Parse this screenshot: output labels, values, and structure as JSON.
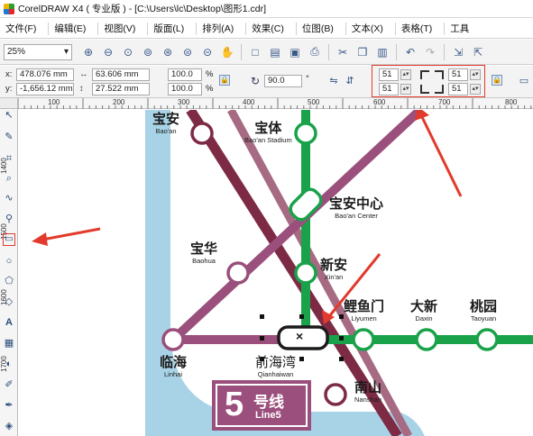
{
  "window": {
    "title": "CorelDRAW X4 ( 专业版 ) - [C:\\Users\\lc\\Desktop\\图形1.cdr]"
  },
  "menu": [
    {
      "label": "文件(F)"
    },
    {
      "label": "编辑(E)"
    },
    {
      "label": "视图(V)"
    },
    {
      "label": "版面(L)"
    },
    {
      "label": "排列(A)"
    },
    {
      "label": "效果(C)"
    },
    {
      "label": "位图(B)"
    },
    {
      "label": "文本(X)"
    },
    {
      "label": "表格(T)"
    },
    {
      "label": "工具"
    }
  ],
  "toolbar": {
    "zoom_value": "25%",
    "icons": [
      "zoom-in-icon",
      "zoom-out-icon",
      "zoom-selected-icon",
      "zoom-all-icon",
      "zoom-page-icon",
      "zoom-width-icon",
      "zoom-height-icon",
      "pan-icon",
      "new-icon",
      "open-icon",
      "save-icon",
      "print-icon",
      "cut-icon",
      "copy-icon",
      "paste-icon",
      "undo-icon",
      "redo-icon",
      "import-icon",
      "export-icon"
    ]
  },
  "property_bar": {
    "x_label": "x:",
    "x_value": "478.076 mm",
    "y_label": "y:",
    "y_value": "-1,656.12 mm",
    "w_value": "63.606 mm",
    "h_value": "27.522 mm",
    "scale_w": "100.0",
    "scale_h": "100.0",
    "percent": "%",
    "rotation": "90.0",
    "degree": "°",
    "corner_tl": "51",
    "corner_bl": "51",
    "corner_tr": "51",
    "corner_br": "51"
  },
  "ruler": {
    "h_labels": [
      "100",
      "200",
      "300",
      "400",
      "500",
      "600",
      "700",
      "800"
    ],
    "v_labels": [
      "1400",
      "1500",
      "1600",
      "1700"
    ]
  },
  "tools": [
    "pick-tool-icon",
    "shape-tool-icon",
    "crop-tool-icon",
    "zoom-tool-icon",
    "freehand-tool-icon",
    "smart-fill-icon",
    "rectangle-tool-icon",
    "ellipse-tool-icon",
    "polygon-tool-icon",
    "basic-shapes-icon",
    "text-tool-icon",
    "table-tool-icon",
    "interactive-blend-icon",
    "eyedropper-icon",
    "outline-tool-icon",
    "fill-tool-icon"
  ],
  "map": {
    "colors": {
      "line1_green": "#19a24a",
      "line5_purple": "#9b4f7c",
      "line_maroon": "#7d2b45",
      "line_rose": "#a66a83",
      "water": "#a8d3e6",
      "annotation_red": "#e23a2c"
    },
    "stations": [
      {
        "cn": "宝安",
        "en": "Bao'an"
      },
      {
        "cn": "宝体",
        "en": "Bao'an Stadium"
      },
      {
        "cn": "宝安中心",
        "en": "Bao'an Center"
      },
      {
        "cn": "宝华",
        "en": "Baohua"
      },
      {
        "cn": "新安",
        "en": "Xin'an"
      },
      {
        "cn": "鲤鱼门",
        "en": "Liyumen"
      },
      {
        "cn": "大新",
        "en": "Daxin"
      },
      {
        "cn": "桃园",
        "en": "Taoyuan"
      },
      {
        "cn": "临海",
        "en": "Linhai"
      },
      {
        "cn": "前海湾",
        "en": "Qianhaiwan"
      },
      {
        "cn": "南山",
        "en": "Nanshan"
      }
    ],
    "line_badge": {
      "number": "5",
      "cn": "号线",
      "en": "Line5"
    },
    "selected_symbol": "×"
  }
}
